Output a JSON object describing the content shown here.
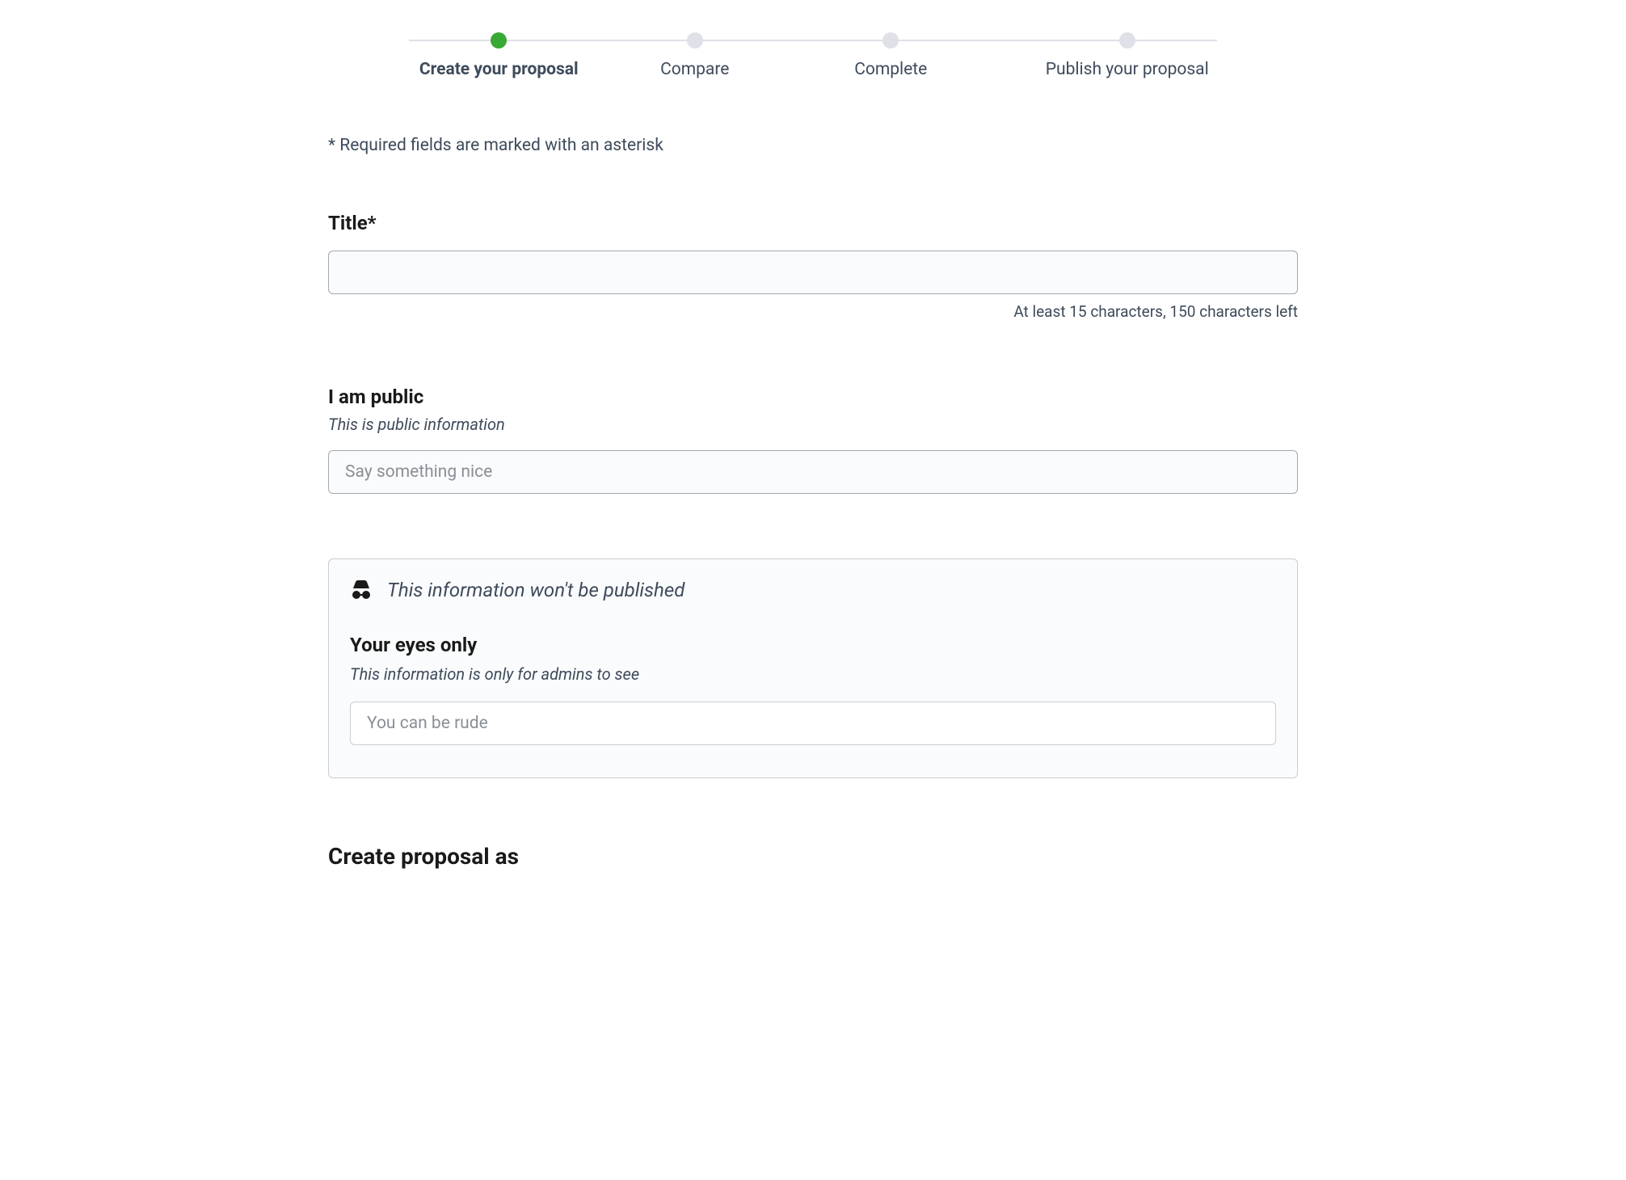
{
  "wizard": {
    "steps": [
      {
        "label": "Create your proposal",
        "active": true
      },
      {
        "label": "Compare",
        "active": false
      },
      {
        "label": "Complete",
        "active": false
      },
      {
        "label": "Publish your proposal",
        "active": false
      }
    ]
  },
  "required_note": "* Required fields are marked with an asterisk",
  "title_field": {
    "label": "Title*",
    "value": "",
    "char_hint": "At least 15 characters, 150 characters left"
  },
  "public_field": {
    "label": "I am public",
    "help": "This is public information",
    "placeholder": "Say something nice",
    "value": ""
  },
  "private_panel": {
    "header": "This information won't be published",
    "field": {
      "label": "Your eyes only",
      "help": "This information is only for admins to see",
      "placeholder": "You can be rude",
      "value": ""
    }
  },
  "create_as_heading": "Create proposal as"
}
